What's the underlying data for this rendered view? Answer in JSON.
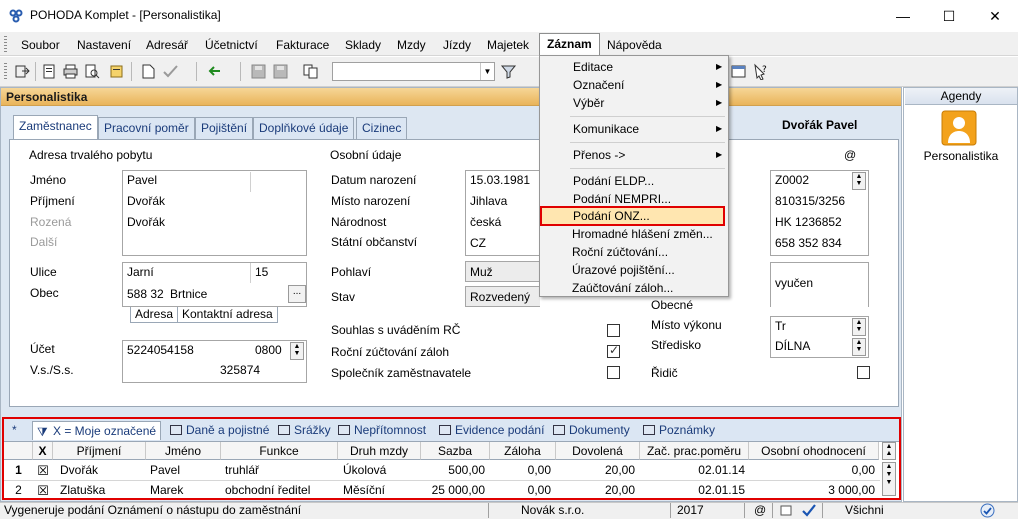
{
  "window": {
    "title": "POHODA Komplet - [Personalistika]",
    "min": "—",
    "max": "☐",
    "close": "✕"
  },
  "menubar": {
    "items": [
      "Soubor",
      "Nastavení",
      "Adresář",
      "Účetnictví",
      "Fakturace",
      "Sklady",
      "Mzdy",
      "Jízdy",
      "Majetek",
      "Záznam",
      "Nápověda"
    ],
    "active": "Záznam"
  },
  "section": {
    "title": "Personalistika"
  },
  "tabs": [
    "Zaměstnanec",
    "Pracovní poměr",
    "Pojištění",
    "Doplňkové údaje",
    "Cizinec"
  ],
  "employee": {
    "display_name": "Dvořák Pavel",
    "address_title": "Adresa trvalého pobytu",
    "labels": {
      "jmeno": "Jméno",
      "prijmeni": "Příjmení",
      "rozena": "Rozená",
      "dalsi": "Další",
      "ulice": "Ulice",
      "obec": "Obec",
      "ucet": "Účet",
      "vs": "V.s./S.s."
    },
    "jmeno": "Pavel",
    "prijmeni": "Dvořák",
    "rozena": "Dvořák",
    "ulice": "Jarní",
    "cislo": "15",
    "psc": "588 32",
    "obec": "Brtnice",
    "address_tabs": [
      "Adresa",
      "Kontaktní adresa"
    ],
    "ucet": "5224054158",
    "kod_banky": "0800",
    "vs": "325874",
    "personal_title": "Osobní údaje",
    "personal_labels": {
      "datum": "Datum narození",
      "misto": "Místo narození",
      "narodnost": "Národnost",
      "obcanstvi": "Státní občanství",
      "pohlavi": "Pohlaví",
      "stav": "Stav",
      "souhlas": "Souhlas s uváděním RČ",
      "rocni": "Roční zúčtování záloh",
      "spolecnik": "Společník zaměstnavatele"
    },
    "datum": "15.03.1981",
    "misto": "Jihlava",
    "narodnost": "česká",
    "obcanstvi": "CZ",
    "pohlavi": "Muž",
    "stav": "Rozvedený",
    "right_labels": {
      "obecne": "Obecné",
      "misto_vykonu": "Místo výkonu",
      "stredisko": "Středisko",
      "ridic": "Řidič"
    },
    "at_sign": "@",
    "osobni_cislo": "Z0002",
    "rodne_cislo": "810315/3256",
    "op": "HK 1236852",
    "telefon": "658 352 834",
    "vzdelani": "vyučen",
    "misto_vykonu": "Tr",
    "stredisko": "DÍLNA"
  },
  "dropdown": {
    "items": [
      {
        "label": "Editace",
        "arrow": true
      },
      {
        "label": "Označení",
        "arrow": true
      },
      {
        "label": "Výběr",
        "arrow": true
      },
      {
        "label": "Komunikace",
        "arrow": true
      },
      {
        "label": "Přenos ->",
        "arrow": true
      },
      {
        "label": "Podání ELDP...",
        "arrow": false
      },
      {
        "label": "Podání NEMPRI...",
        "arrow": false
      },
      {
        "label": "Podání ONZ...",
        "arrow": false
      },
      {
        "label": "Hromadné hlášení změn...",
        "arrow": false
      },
      {
        "label": "Roční zúčtování...",
        "arrow": false
      },
      {
        "label": "Úrazové pojištění...",
        "arrow": false
      },
      {
        "label": "Zaúčtování záloh...",
        "arrow": false
      }
    ],
    "highlighted": "Podání ONZ..."
  },
  "agendy": {
    "header": "Agendy",
    "item": "Personalistika"
  },
  "bottom_tabs": [
    "X = Moje označené",
    "Daně a pojistné",
    "Srážky",
    "Nepřítomnost",
    "Evidence podání",
    "Dokumenty",
    "Poznámky"
  ],
  "bottom_star": "*",
  "grid": {
    "headers": [
      "X",
      "Příjmení",
      "Jméno",
      "Funkce",
      "Druh mzdy",
      "Sazba",
      "Záloha",
      "Dovolená",
      "Zač. prac.poměru",
      "Osobní ohodnocení"
    ],
    "rows": [
      {
        "n": "1",
        "x": "☒",
        "prijmeni": "Dvořák",
        "jmeno": "Pavel",
        "funkce": "truhlář",
        "druh": "Úkolová",
        "sazba": "500,00",
        "zaloha": "0,00",
        "dovolena": "20,00",
        "zacatek": "02.01.14",
        "ohodnoceni": "0,00"
      },
      {
        "n": "2",
        "x": "☒",
        "prijmeni": "Zlatuška",
        "jmeno": "Marek",
        "funkce": "obchodní ředitel",
        "druh": "Měsíční",
        "sazba": "25 000,00",
        "zaloha": "0,00",
        "dovolena": "20,00",
        "zacatek": "02.01.15",
        "ohodnoceni": "3 000,00"
      }
    ]
  },
  "status": {
    "message": "Vygeneruje podání Oznámení o nástupu do zaměstnání",
    "company": "Novák s.r.o.",
    "year": "2017",
    "at": "@",
    "filter": "Všichni"
  },
  "colors": {
    "highlight_border": "#e00000",
    "section_header": "#e9b45a",
    "panel_bg": "#dde7f2"
  }
}
